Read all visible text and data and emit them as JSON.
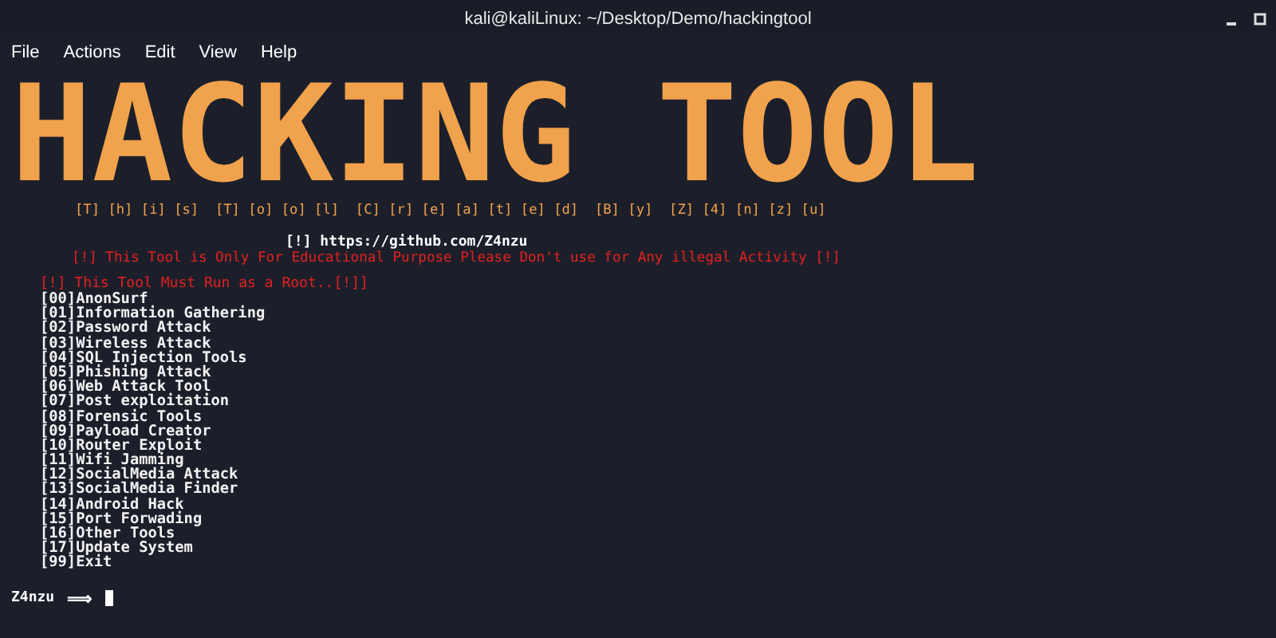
{
  "window": {
    "title": "kali@kaliLinux: ~/Desktop/Demo/hackingtool"
  },
  "menu": [
    "File",
    "Actions",
    "Edit",
    "View",
    "Help"
  ],
  "banner": {
    "title": "HACKING TOOL",
    "subtitle": "[T] [h] [i] [s]  [T] [o] [o] [l]  [C] [r] [e] [a] [t] [e] [d]  [B] [y]  [Z] [4] [n] [z] [u]"
  },
  "link_line": "[!] https://github.com/Z4nzu",
  "warning": "[!] This Tool is Only For Educational Purpose Please Don't use for Any illegal Activity [!]",
  "root_warning": "[!] This Tool Must Run as a Root..[!]]",
  "options": [
    "[00]AnonSurf",
    "[01]Information Gathering",
    "[02]Password Attack",
    "[03]Wireless Attack",
    "[04]SQL Injection Tools",
    "[05]Phishing Attack",
    "[06]Web Attack Tool",
    "[07]Post exploitation",
    "[08]Forensic Tools",
    "[09]Payload Creator",
    "[10]Router Exploit",
    "[11]Wifi Jamming",
    "[12]SocialMedia Attack",
    "[13]SocialMedia Finder",
    "[14]Android Hack",
    "[15]Port Forwading",
    "[16]Other Tools",
    "[17]Update System",
    "[99]Exit"
  ],
  "prompt": {
    "label": "Z4nzu",
    "arrow": "⟹"
  }
}
